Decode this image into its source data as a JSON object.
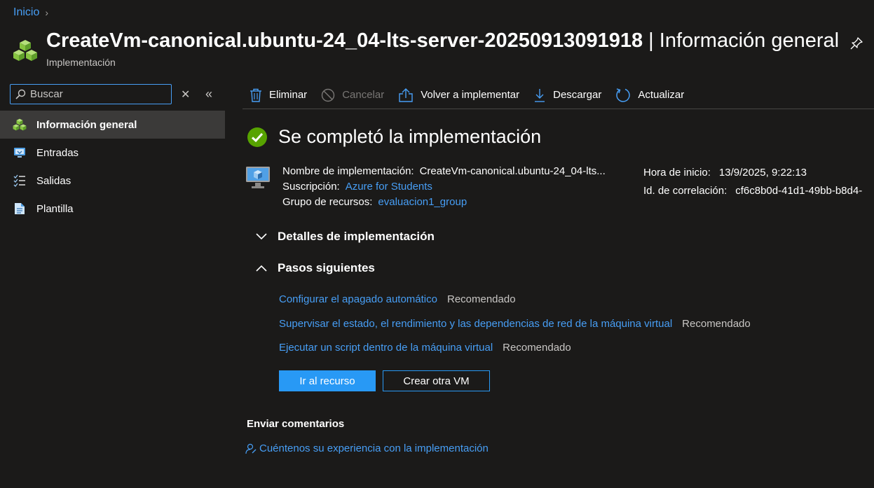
{
  "breadcrumb": {
    "home": "Inicio"
  },
  "header": {
    "title_bold": "CreateVm-canonical.ubuntu-24_04-lts-server-20250913091918",
    "title_separator": " | ",
    "title_section": "Información general",
    "subtitle": "Implementación",
    "resource_icon": "deployment-cubes-icon",
    "pin_icon": "pin-icon"
  },
  "sidebar": {
    "search_placeholder": "Buscar",
    "items": [
      {
        "label": "Información general",
        "icon": "cubes-icon",
        "active": true
      },
      {
        "label": "Entradas",
        "icon": "inputs-icon",
        "active": false
      },
      {
        "label": "Salidas",
        "icon": "outputs-icon",
        "active": false
      },
      {
        "label": "Plantilla",
        "icon": "template-icon",
        "active": false
      }
    ]
  },
  "toolbar": {
    "delete": "Eliminar",
    "cancel": "Cancelar",
    "redeploy": "Volver a implementar",
    "download": "Descargar",
    "refresh": "Actualizar"
  },
  "status": {
    "title": "Se completó la implementación",
    "icon": "success-check-icon"
  },
  "details": {
    "deployment_name_label": "Nombre de implementación:",
    "deployment_name_value": "CreateVm-canonical.ubuntu-24_04-lts...",
    "subscription_label": "Suscripción:",
    "subscription_value": "Azure for Students",
    "resource_group_label": "Grupo de recursos:",
    "resource_group_value": "evaluacion1_group",
    "start_time_label": "Hora de inicio:",
    "start_time_value": "13/9/2025, 9:22:13",
    "correlation_label": "Id. de correlación:",
    "correlation_value": "cf6c8b0d-41d1-49bb-b8d4-"
  },
  "sections": {
    "deployment_details": "Detalles de implementación",
    "next_steps": "Pasos siguientes"
  },
  "next_steps": [
    {
      "link": "Configurar el apagado automático",
      "tag": "Recomendado"
    },
    {
      "link": "Supervisar el estado, el rendimiento y las dependencias de red de la máquina virtual",
      "tag": "Recomendado"
    },
    {
      "link": "Ejecutar un script dentro de la máquina virtual",
      "tag": "Recomendado"
    }
  ],
  "actions": {
    "go_to_resource": "Ir al recurso",
    "create_another": "Crear otra VM"
  },
  "feedback": {
    "title": "Enviar comentarios",
    "link": "Cuéntenos su experiencia con la implementación"
  },
  "colors": {
    "background": "#1b1a19",
    "link": "#479ef5",
    "primary": "#2899f5",
    "success": "#57a300",
    "cube_green": "#86c440"
  }
}
